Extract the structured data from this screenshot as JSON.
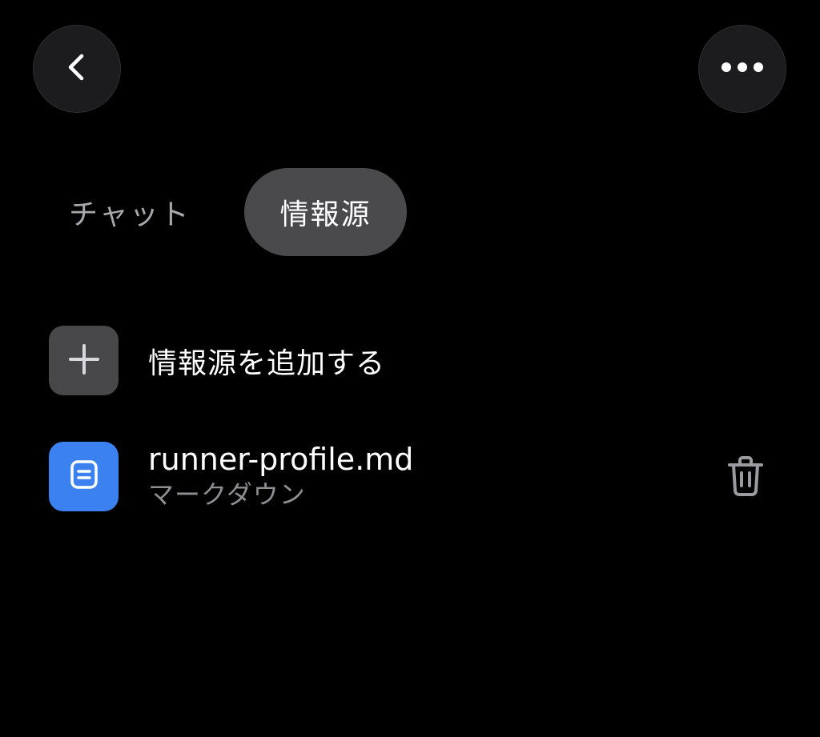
{
  "header": {
    "back_icon": "chevron-left-icon",
    "more_icon": "ellipsis-horizontal-icon"
  },
  "tabs": [
    {
      "label": "チャット",
      "active": false
    },
    {
      "label": "情報源",
      "active": true
    }
  ],
  "add_source": {
    "label": "情報源を追加する",
    "icon": "plus-icon"
  },
  "sources": [
    {
      "name": "runner-profile.md",
      "type": "マークダウン",
      "icon": "document-icon",
      "action_icon": "trash-icon"
    }
  ],
  "colors": {
    "background": "#000000",
    "active_tab": "#4a4a4c",
    "file_tile": "#3b82f0",
    "add_tile": "#48484a",
    "secondary_text": "#8e8e93"
  }
}
